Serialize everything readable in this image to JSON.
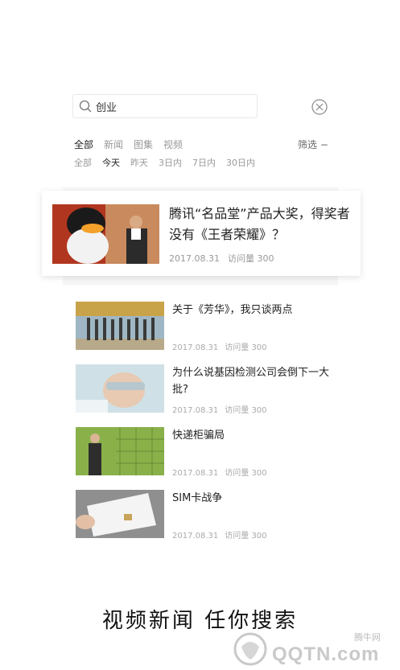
{
  "search": {
    "query": "创业"
  },
  "filters": {
    "types": [
      "全部",
      "新闻",
      "图集",
      "视频"
    ],
    "type_active": 0,
    "times": [
      "全部",
      "今天",
      "昨天",
      "3日内",
      "7日内",
      "30日内"
    ],
    "time_active": 1,
    "filter_label": "筛选 −"
  },
  "featured": {
    "title": "腾讯“名品堂”产品大奖，得奖者没有《王者荣耀》？",
    "date": "2017.08.31",
    "views": "访问量 300"
  },
  "articles": [
    {
      "title": "关于《芳华》，我只谈两点",
      "date": "2017.08.31",
      "views": "访问量 300"
    },
    {
      "title": "为什么说基因检测公司会倒下一大批?",
      "date": "2017.08.31",
      "views": "访问量 300"
    },
    {
      "title": "快递柜骗局",
      "date": "2017.08.31",
      "views": "访问量 300"
    },
    {
      "title": "SIM卡战争",
      "date": "2017.08.31",
      "views": "访问量 300"
    }
  ],
  "slogan": "视频新闻 任你搜索",
  "watermark": {
    "brand": "QQTN.com",
    "label": "腾牛网"
  },
  "colors": {
    "background": "#ffffff",
    "text": "#222222",
    "muted": "#999999"
  }
}
